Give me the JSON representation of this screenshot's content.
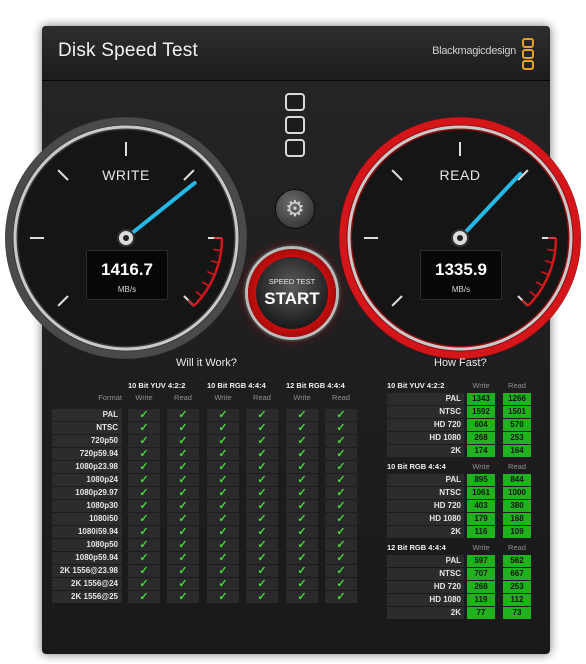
{
  "window": {
    "title": "Disk Speed Test",
    "brand": "Blackmagicdesign"
  },
  "colors": {
    "accent_red": "#d4161b",
    "needle_cyan": "#25b8e6",
    "check_green": "#43d936",
    "cell_green": "#1fb21f"
  },
  "gauges": {
    "write": {
      "label": "WRITE",
      "value": "1416.7",
      "unit": "MB/s",
      "needle_fraction": 0.69,
      "active": false
    },
    "read": {
      "label": "READ",
      "value": "1335.9",
      "unit": "MB/s",
      "needle_fraction": 0.66,
      "active": true
    }
  },
  "controls": {
    "start_small": "SPEED TEST",
    "start_label": "START",
    "gear_icon": "gear-icon",
    "toggle_icon": "settings-toggle-icon"
  },
  "will_it_work": {
    "title": "Will it Work?",
    "format_header": "Format",
    "groups": [
      "10 Bit YUV 4:2:2",
      "10 Bit RGB 4:4:4",
      "12 Bit RGB 4:4:4"
    ],
    "subheaders": [
      "Write",
      "Read"
    ],
    "check_symbol": "✓",
    "rows": [
      "PAL",
      "NTSC",
      "720p50",
      "720p59.94",
      "1080p23.98",
      "1080p24",
      "1080p29.97",
      "1080p30",
      "1080i50",
      "1080i59.94",
      "1080p50",
      "1080p59.94",
      "2K 1556@23.98",
      "2K 1556@24",
      "2K 1556@25"
    ]
  },
  "how_fast": {
    "title": "How Fast?",
    "col_headers": [
      "Write",
      "Read"
    ],
    "groups": [
      {
        "name": "10 Bit YUV 4:2:2",
        "rows": [
          {
            "format": "PAL",
            "write": "1343",
            "read": "1266"
          },
          {
            "format": "NTSC",
            "write": "1592",
            "read": "1501"
          },
          {
            "format": "HD 720",
            "write": "604",
            "read": "570"
          },
          {
            "format": "HD 1080",
            "write": "268",
            "read": "253"
          },
          {
            "format": "2K",
            "write": "174",
            "read": "164"
          }
        ]
      },
      {
        "name": "10 Bit RGB 4:4:4",
        "rows": [
          {
            "format": "PAL",
            "write": "895",
            "read": "844"
          },
          {
            "format": "NTSC",
            "write": "1061",
            "read": "1000"
          },
          {
            "format": "HD 720",
            "write": "403",
            "read": "380"
          },
          {
            "format": "HD 1080",
            "write": "179",
            "read": "168"
          },
          {
            "format": "2K",
            "write": "116",
            "read": "109"
          }
        ]
      },
      {
        "name": "12 Bit RGB 4:4:4",
        "rows": [
          {
            "format": "PAL",
            "write": "597",
            "read": "562"
          },
          {
            "format": "NTSC",
            "write": "707",
            "read": "667"
          },
          {
            "format": "HD 720",
            "write": "268",
            "read": "253"
          },
          {
            "format": "HD 1080",
            "write": "119",
            "read": "112"
          },
          {
            "format": "2K",
            "write": "77",
            "read": "73"
          }
        ]
      }
    ]
  }
}
